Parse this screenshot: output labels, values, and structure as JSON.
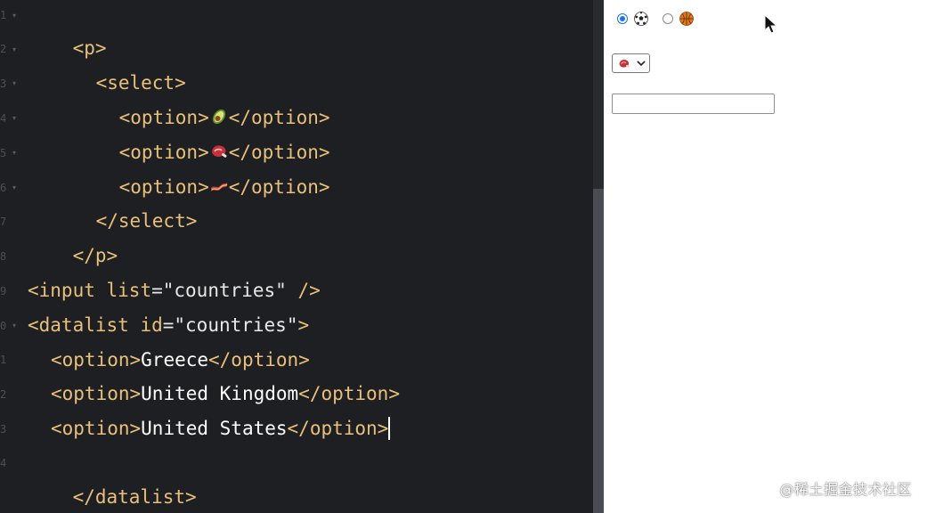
{
  "editor": {
    "gutter_numbers": [
      "1",
      "2",
      "3",
      "4",
      "5",
      "6",
      "7",
      "8",
      "9",
      "0",
      "1",
      "2",
      "3",
      "4"
    ],
    "lines": {
      "l1_open_p": "<p>",
      "l2_open_select": "<select>",
      "l3_open": "<option>",
      "l3_close": "</option>",
      "l4_open": "<option>",
      "l4_close": "</option>",
      "l5_open": "<option>",
      "l5_close": "</option>",
      "l6_close_select": "</select>",
      "l7_close_p": "</p>",
      "l9_input_open": "<input ",
      "l9_attr": "list",
      "l9_eq": "=",
      "l9_value": "\"countries\"",
      "l9_end": " />",
      "l10_open": "<datalist ",
      "l10_attr": "id",
      "l10_eq": "=",
      "l10_value": "\"countries\"",
      "l10_end": ">",
      "l11_open": "<option>",
      "l11_text": "Greece",
      "l11_close": "</option>",
      "l12_open": "<option>",
      "l12_text": "United Kingdom",
      "l12_close": "</option>",
      "l13_open": "<option>",
      "l13_text": "United States",
      "l13_close": "</option>",
      "l14_close": "</datalist>"
    },
    "emoji_icons": [
      "avocado-icon",
      "meat-icon",
      "bacon-icon"
    ]
  },
  "preview": {
    "radios": [
      {
        "checked": true,
        "icon": "soccer-ball-icon"
      },
      {
        "checked": false,
        "icon": "basketball-icon"
      }
    ],
    "select_icon": "meat-icon",
    "input_value": "",
    "input_placeholder": ""
  },
  "watermark": "@稀土掘金技术社区",
  "colors": {
    "editor_bg": "#1e1f22",
    "tag": "#e8c07a",
    "text": "#e8e8e8",
    "radio_accent": "#1a73e8"
  }
}
